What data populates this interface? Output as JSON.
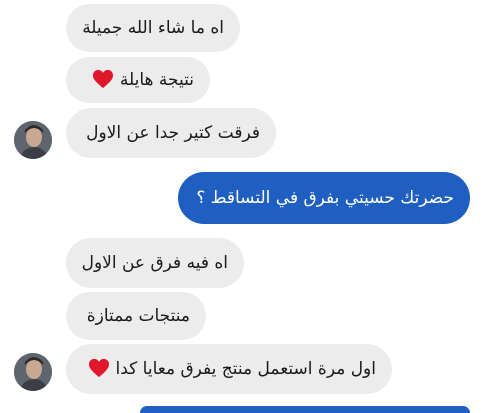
{
  "messages": [
    {
      "id": "m1",
      "direction": "incoming",
      "text": "اه ما شاء الله جميلة",
      "emoji": null
    },
    {
      "id": "m2",
      "direction": "incoming",
      "text": "نتيجة هايلة",
      "emoji": "red-heart"
    },
    {
      "id": "m3",
      "direction": "incoming",
      "text": "فرقت كتير جدا عن الاول",
      "emoji": null
    },
    {
      "id": "m4",
      "direction": "outgoing",
      "text": "حضرتك حسيتي بفرق في التساقط ؟",
      "emoji": null
    },
    {
      "id": "m5",
      "direction": "incoming",
      "text": "اه فيه فرق عن الاول",
      "emoji": null
    },
    {
      "id": "m6",
      "direction": "incoming",
      "text": "منتجات ممتازة",
      "emoji": null
    },
    {
      "id": "m7",
      "direction": "incoming",
      "text": "اول مرة استعمل منتج يفرق معايا كدا",
      "emoji": "red-heart"
    }
  ],
  "colors": {
    "incoming_bubble": "#ececec",
    "outgoing_bubble": "#1e5fc1",
    "heart": "#e0162b"
  }
}
